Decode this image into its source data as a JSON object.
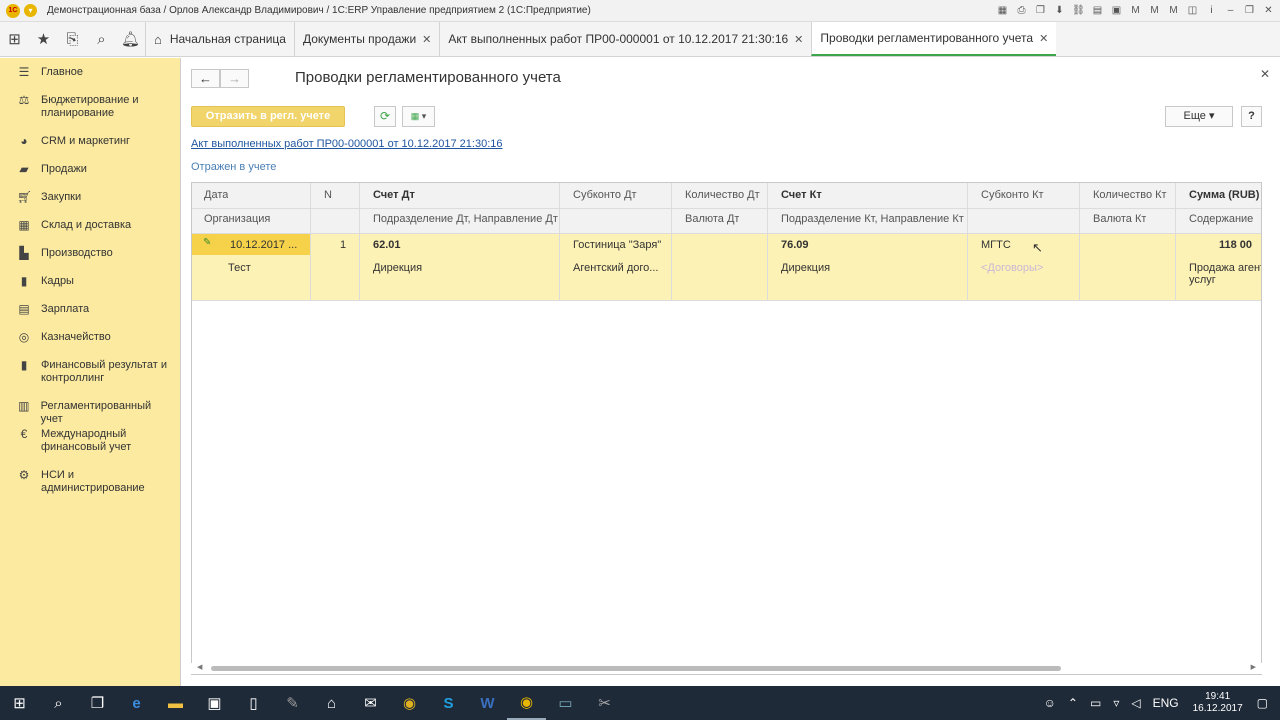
{
  "titlebar": {
    "app_logo": "1С",
    "title": "Демонстрационная база / Орлов Александр Владимирович / 1С:ERP Управление предприятием 2  (1С:Предприятие)"
  },
  "tabs": [
    {
      "label": "Начальная страница",
      "closable": false
    },
    {
      "label": "Документы продажи",
      "closable": true
    },
    {
      "label": "Акт выполненных работ ПР00-000001 от 10.12.2017 21:30:16",
      "closable": true
    },
    {
      "label": "Проводки регламентированного учета",
      "closable": true,
      "active": true
    }
  ],
  "sidebar": {
    "items": [
      {
        "label": "Главное",
        "icon": "menu-icon"
      },
      {
        "label": "Бюджетирование и планирование",
        "icon": "budget-icon"
      },
      {
        "label": "CRM и маркетинг",
        "icon": "crm-icon"
      },
      {
        "label": "Продажи",
        "icon": "sales-icon"
      },
      {
        "label": "Закупки",
        "icon": "cart-icon"
      },
      {
        "label": "Склад и доставка",
        "icon": "warehouse-icon"
      },
      {
        "label": "Производство",
        "icon": "factory-icon"
      },
      {
        "label": "Кадры",
        "icon": "people-icon"
      },
      {
        "label": "Зарплата",
        "icon": "salary-icon"
      },
      {
        "label": "Казначейство",
        "icon": "treasury-icon"
      },
      {
        "label": "Финансовый результат и контроллинг",
        "icon": "chart-icon"
      },
      {
        "label": "Регламентированный учет",
        "icon": "ledger-icon"
      },
      {
        "label": "Международный финансовый учет",
        "icon": "euro-icon"
      },
      {
        "label": "НСИ и администрирование",
        "icon": "gear-icon"
      }
    ]
  },
  "form": {
    "title": "Проводки регламентированного учета",
    "post_button": "Отразить в регл. учете",
    "more_button": "Еще",
    "help_button": "?",
    "document_link": "Акт выполненных работ ПР00-000001 от 10.12.2017 21:30:16",
    "status": "Отражен в учете"
  },
  "table": {
    "headers_top": [
      "Дата",
      "N",
      "Счет Дт",
      "Субконто Дт",
      "Количество Дт",
      "Счет Кт",
      "Субконто Кт",
      "Количество Кт",
      "Сумма (RUB)"
    ],
    "headers_bottom": [
      "Организация",
      "",
      "Подразделение Дт, Направление Дт",
      "",
      "Валюта Дт",
      "Подразделение Кт, Направление Кт",
      "",
      "Валюта Кт",
      "Содержание"
    ],
    "row": {
      "date": "10.12.2017 ...",
      "n": "1",
      "account_dt": "62.01",
      "subconto_dt": "Гостиница \"Заря\"",
      "account_kt": "76.09",
      "subconto_kt": "МГТС",
      "sum": "118 00",
      "organization": "Тест",
      "dept_dt": "Дирекция",
      "subconto_dt2": "Агентский дого...",
      "dept_kt": "Дирекция",
      "subconto_kt2_placeholder": "<Договоры>",
      "content_line1": "Продажа агент",
      "content_line2": "услуг"
    }
  },
  "taskbar": {
    "language": "ENG",
    "time": "19:41",
    "date": "16.12.2017"
  }
}
